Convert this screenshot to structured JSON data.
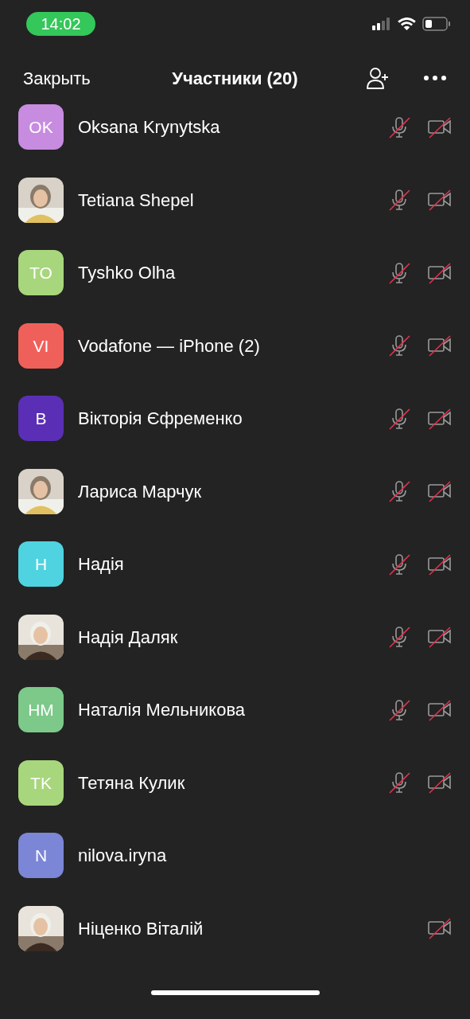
{
  "status_bar": {
    "time": "14:02"
  },
  "header": {
    "close": "Закрыть",
    "title": "Участники (20)"
  },
  "participants": [
    {
      "name": "Oksana Krynytska",
      "avatar": {
        "kind": "initials",
        "initials": "OK",
        "color": "#c78be0"
      },
      "mic_muted": true,
      "video_off": true
    },
    {
      "name": "Tetiana Shepel",
      "mic_muted": true,
      "video_off": true
    },
    {
      "name": "Tyshko Olha",
      "avatar": {
        "kind": "initials",
        "initials": "TO",
        "color": "#a8d67c"
      },
      "mic_muted": true,
      "video_off": true
    },
    {
      "name": "Vodafone — iPhone (2)",
      "avatar": {
        "kind": "initials",
        "initials": "VI",
        "color": "#f0605a"
      },
      "mic_muted": true,
      "video_off": true
    },
    {
      "name": "Вікторія Єфременко",
      "avatar": {
        "kind": "initials",
        "initials": "B",
        "color": "#5a2fb5"
      },
      "mic_muted": true,
      "video_off": true
    },
    {
      "name": "Лариса Марчук",
      "mic_muted": true,
      "video_off": true
    },
    {
      "name": "Надія",
      "avatar": {
        "kind": "initials",
        "initials": "H",
        "color": "#4fd3e0"
      },
      "mic_muted": true,
      "video_off": true
    },
    {
      "name": "Надія Даляк",
      "mic_muted": true,
      "video_off": true
    },
    {
      "name": "Наталія Мельникова",
      "avatar": {
        "kind": "initials",
        "initials": "HM",
        "color": "#7cc98a"
      },
      "mic_muted": true,
      "video_off": true
    },
    {
      "name": "Тетяна Кулик",
      "avatar": {
        "kind": "initials",
        "initials": "TK",
        "color": "#a8d67c"
      },
      "mic_muted": true,
      "video_off": true
    },
    {
      "name": "nilova.iryna",
      "avatar": {
        "kind": "initials",
        "initials": "N",
        "color": "#7b86d6"
      },
      "mic_muted": false,
      "video_off": false
    },
    {
      "name": "Ніценко Віталій",
      "mic_muted": false,
      "video_off": true
    }
  ]
}
